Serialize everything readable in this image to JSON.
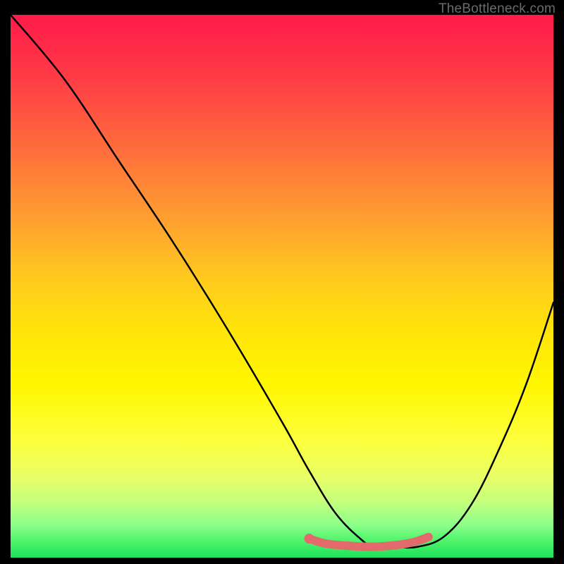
{
  "watermark": "TheBottleneck.com",
  "chart_data": {
    "type": "line",
    "title": "",
    "xlabel": "",
    "ylabel": "",
    "xlim": [
      0,
      100
    ],
    "ylim": [
      0,
      100
    ],
    "grid": false,
    "series": [
      {
        "name": "curve",
        "x": [
          0,
          10,
          20,
          30,
          40,
          50,
          55,
          60,
          65,
          67,
          70,
          75,
          80,
          85,
          90,
          95,
          100
        ],
        "y": [
          100,
          88,
          73,
          58,
          42,
          25,
          16,
          8,
          3,
          2,
          2,
          2,
          4,
          10,
          20,
          32,
          47
        ]
      },
      {
        "name": "highlight",
        "x": [
          55,
          58,
          62,
          66,
          70,
          74,
          77
        ],
        "y": [
          3.5,
          2.6,
          2.2,
          2.0,
          2.2,
          2.8,
          3.8
        ]
      }
    ],
    "marker": {
      "x": 55,
      "y": 3.5
    }
  }
}
